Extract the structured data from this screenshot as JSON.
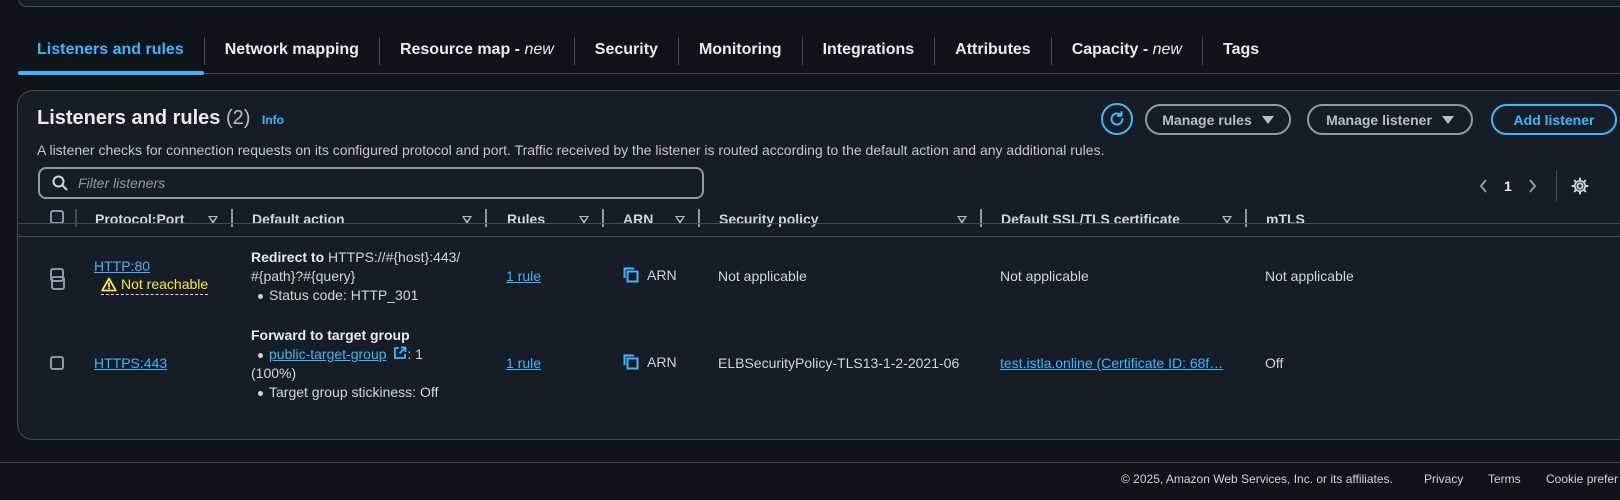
{
  "tabs": [
    {
      "label": "Listeners and rules",
      "tag": "",
      "active": true
    },
    {
      "label": "Network mapping",
      "tag": ""
    },
    {
      "label": "Resource map - ",
      "tag": "new"
    },
    {
      "label": "Security",
      "tag": ""
    },
    {
      "label": "Monitoring",
      "tag": ""
    },
    {
      "label": "Integrations",
      "tag": ""
    },
    {
      "label": "Attributes",
      "tag": ""
    },
    {
      "label": "Capacity - ",
      "tag": "new"
    },
    {
      "label": "Tags",
      "tag": ""
    }
  ],
  "panel": {
    "title": "Listeners and rules",
    "count": "(2)",
    "info": "Info",
    "description": "A listener checks for connection requests on its configured protocol and port. Traffic received by the listener is routed according to the default action and any additional rules.",
    "manage_rules": "Manage rules",
    "manage_listener": "Manage listener",
    "add_listener": "Add listener",
    "filter_placeholder": "Filter listeners",
    "page": "1"
  },
  "columns": {
    "protocol_port": "Protocol:Port",
    "default_action": "Default action",
    "rules": "Rules",
    "arn": "ARN",
    "security_policy": "Security policy",
    "default_cert": "Default SSL/TLS certificate",
    "mtls": "mTLS"
  },
  "rows": [
    {
      "protocol_port": "HTTP:80",
      "warning": "Not reachable",
      "action_bold": "Redirect to",
      "action_line1": " HTTPS://#{host}:443/",
      "action_line2": "#{path}?#{query}",
      "action_bullet1": "Status code: HTTP_301",
      "rules": "1 rule",
      "arn": "ARN",
      "security_policy": "Not applicable",
      "cert": "Not applicable",
      "mtls": "Not applicable"
    },
    {
      "protocol_port": "HTTPS:443",
      "action_bold": "Forward to target group",
      "target_group": "public-target-group",
      "weight": ": 1",
      "weight_pct": "(100%)",
      "stickiness": "Target group stickiness: Off",
      "rules": "1 rule",
      "arn": "ARN",
      "security_policy": "ELBSecurityPolicy-TLS13-1-2-2021-06",
      "cert": "test.istla.online (Certificate ID: 68f…",
      "mtls": "Off"
    }
  ],
  "footer": {
    "copyright": "© 2025, Amazon Web Services, Inc. or its affiliates.",
    "privacy": "Privacy",
    "terms": "Terms",
    "cookie": "Cookie prefer"
  }
}
